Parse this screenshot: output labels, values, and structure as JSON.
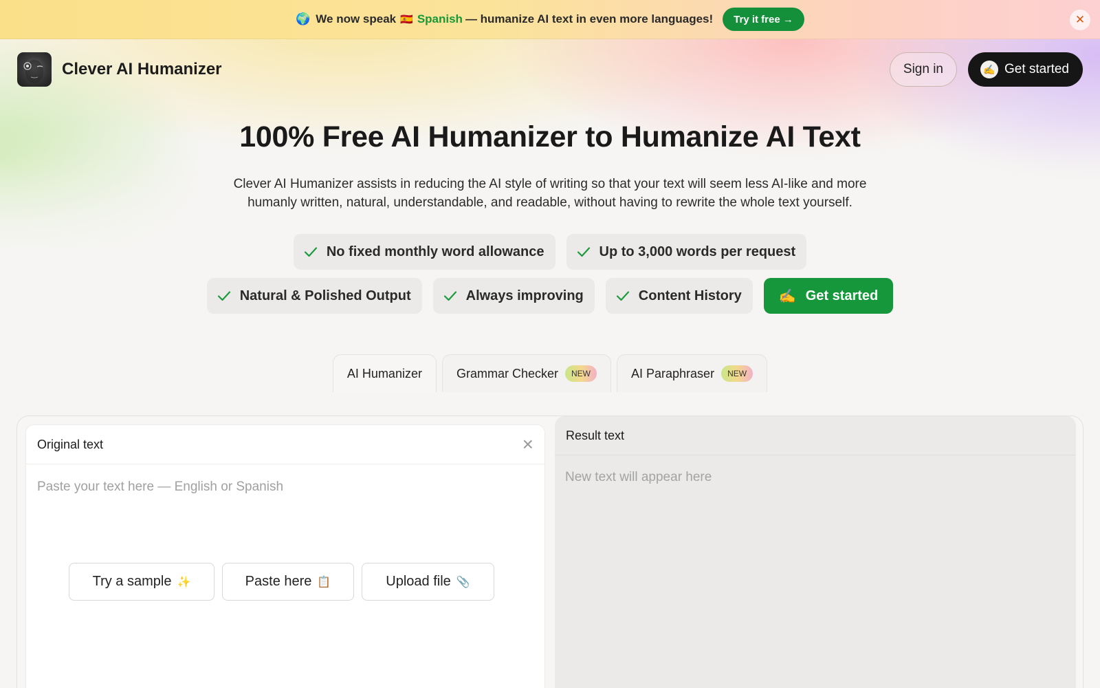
{
  "announcement": {
    "globe_icon": "🌍",
    "prefix": "We now speak",
    "flag_icon": "🇪🇸",
    "language": "Spanish",
    "suffix": "— humanize AI text in even more languages!",
    "cta_label": "Try it free →",
    "close_icon": "✕"
  },
  "header": {
    "brand_name": "Clever AI Humanizer",
    "sign_in_label": "Sign in",
    "get_started_emoji": "✍️",
    "get_started_label": "Get started"
  },
  "hero": {
    "title": "100% Free AI Humanizer to Humanize AI Text",
    "subtitle": "Clever AI Humanizer assists in reducing the AI style of writing so that your text will seem less AI-like and more humanly written, natural, understandable, and readable, without having to rewrite the whole text yourself."
  },
  "features": {
    "row1": [
      "No fixed monthly word allowance",
      "Up to 3,000 words per request"
    ],
    "row2": [
      "Natural & Polished Output",
      "Always improving",
      "Content History"
    ],
    "cta_emoji": "✍️",
    "cta_label": "Get started"
  },
  "tabs": [
    {
      "label": "AI Humanizer",
      "badge": ""
    },
    {
      "label": "Grammar Checker",
      "badge": "NEW"
    },
    {
      "label": "AI Paraphraser",
      "badge": "NEW"
    }
  ],
  "editor": {
    "original_title": "Original text",
    "input_placeholder": "Paste your text here — English or Spanish",
    "clear_icon": "×",
    "buttons": [
      {
        "label": "Try a sample",
        "icon": "✨"
      },
      {
        "label": "Paste here",
        "icon": "📋"
      },
      {
        "label": "Upload file",
        "icon": "📎"
      }
    ],
    "result_title": "Result text",
    "result_placeholder": "New text will appear here"
  },
  "colors": {
    "accent_green": "#16973b",
    "dark_button": "#161616"
  }
}
